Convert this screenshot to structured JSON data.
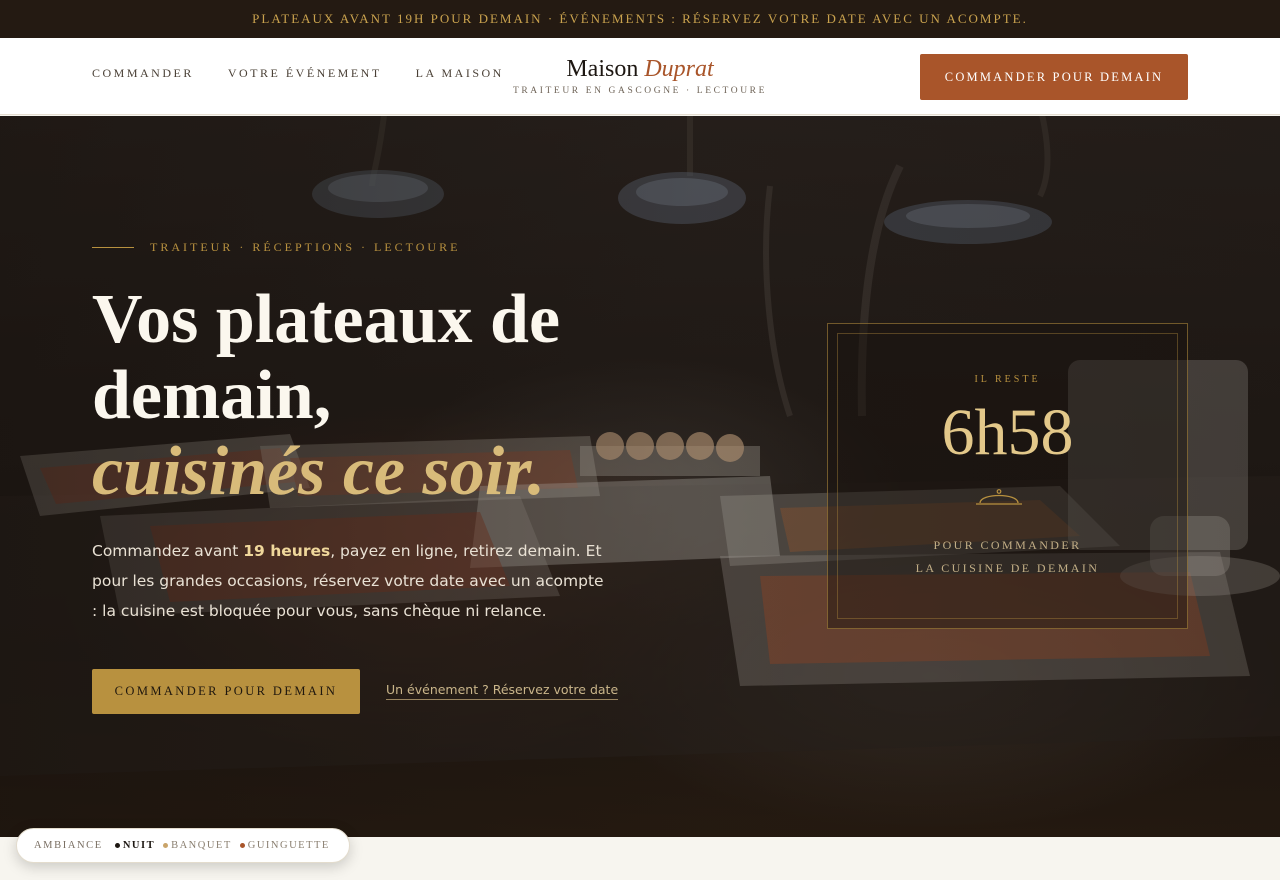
{
  "announcement": "PLATEAUX AVANT 19H POUR DEMAIN · ÉVÉNEMENTS : RÉSERVEZ VOTRE DATE AVEC UN ACOMPTE.",
  "nav": {
    "items": [
      {
        "label": "COMMANDER"
      },
      {
        "label": "VOTRE ÉVÉNEMENT"
      },
      {
        "label": "LA MAISON"
      }
    ]
  },
  "logo": {
    "name": "Maison",
    "name_accent": "Duprat",
    "tagline": "TRAITEUR EN GASCOGNE · LECTOURE"
  },
  "header": {
    "cta_label": "COMMANDER POUR DEMAIN"
  },
  "hero": {
    "eyebrow": "TRAITEUR · RÉCEPTIONS · LECTOURE",
    "headline_line1": "Vos plateaux de",
    "headline_line2": "demain,",
    "headline_accent": "cuisinés ce soir.",
    "lede_before": "Commandez avant ",
    "lede_highlight": "19 heures",
    "lede_after": ", payez en ligne, retirez demain. Et pour les grandes occasions, réservez votre date avec un acompte : la cuisine est bloquée pour vous, sans chèque ni relance.",
    "cta_label": "COMMANDER POUR DEMAIN",
    "secondary_link": "Un événement ? Réservez votre date"
  },
  "countdown": {
    "label": "IL RESTE",
    "value": "6h58",
    "icon": "cloche-icon",
    "caption_line1": "POUR COMMANDER",
    "caption_line2": "LA CUISINE DE DEMAIN"
  },
  "ambiance": {
    "title": "AMBIANCE",
    "options": [
      {
        "label": "NUIT",
        "color": "#1d1712",
        "active": true
      },
      {
        "label": "BANQUET",
        "color": "#c9a46a",
        "active": false
      },
      {
        "label": "GUINGUETTE",
        "color": "#a9552a",
        "active": false
      }
    ]
  },
  "colors": {
    "accent_rust": "#a9552a",
    "accent_gold": "#b8913f",
    "topbar_bg": "#241a12"
  }
}
